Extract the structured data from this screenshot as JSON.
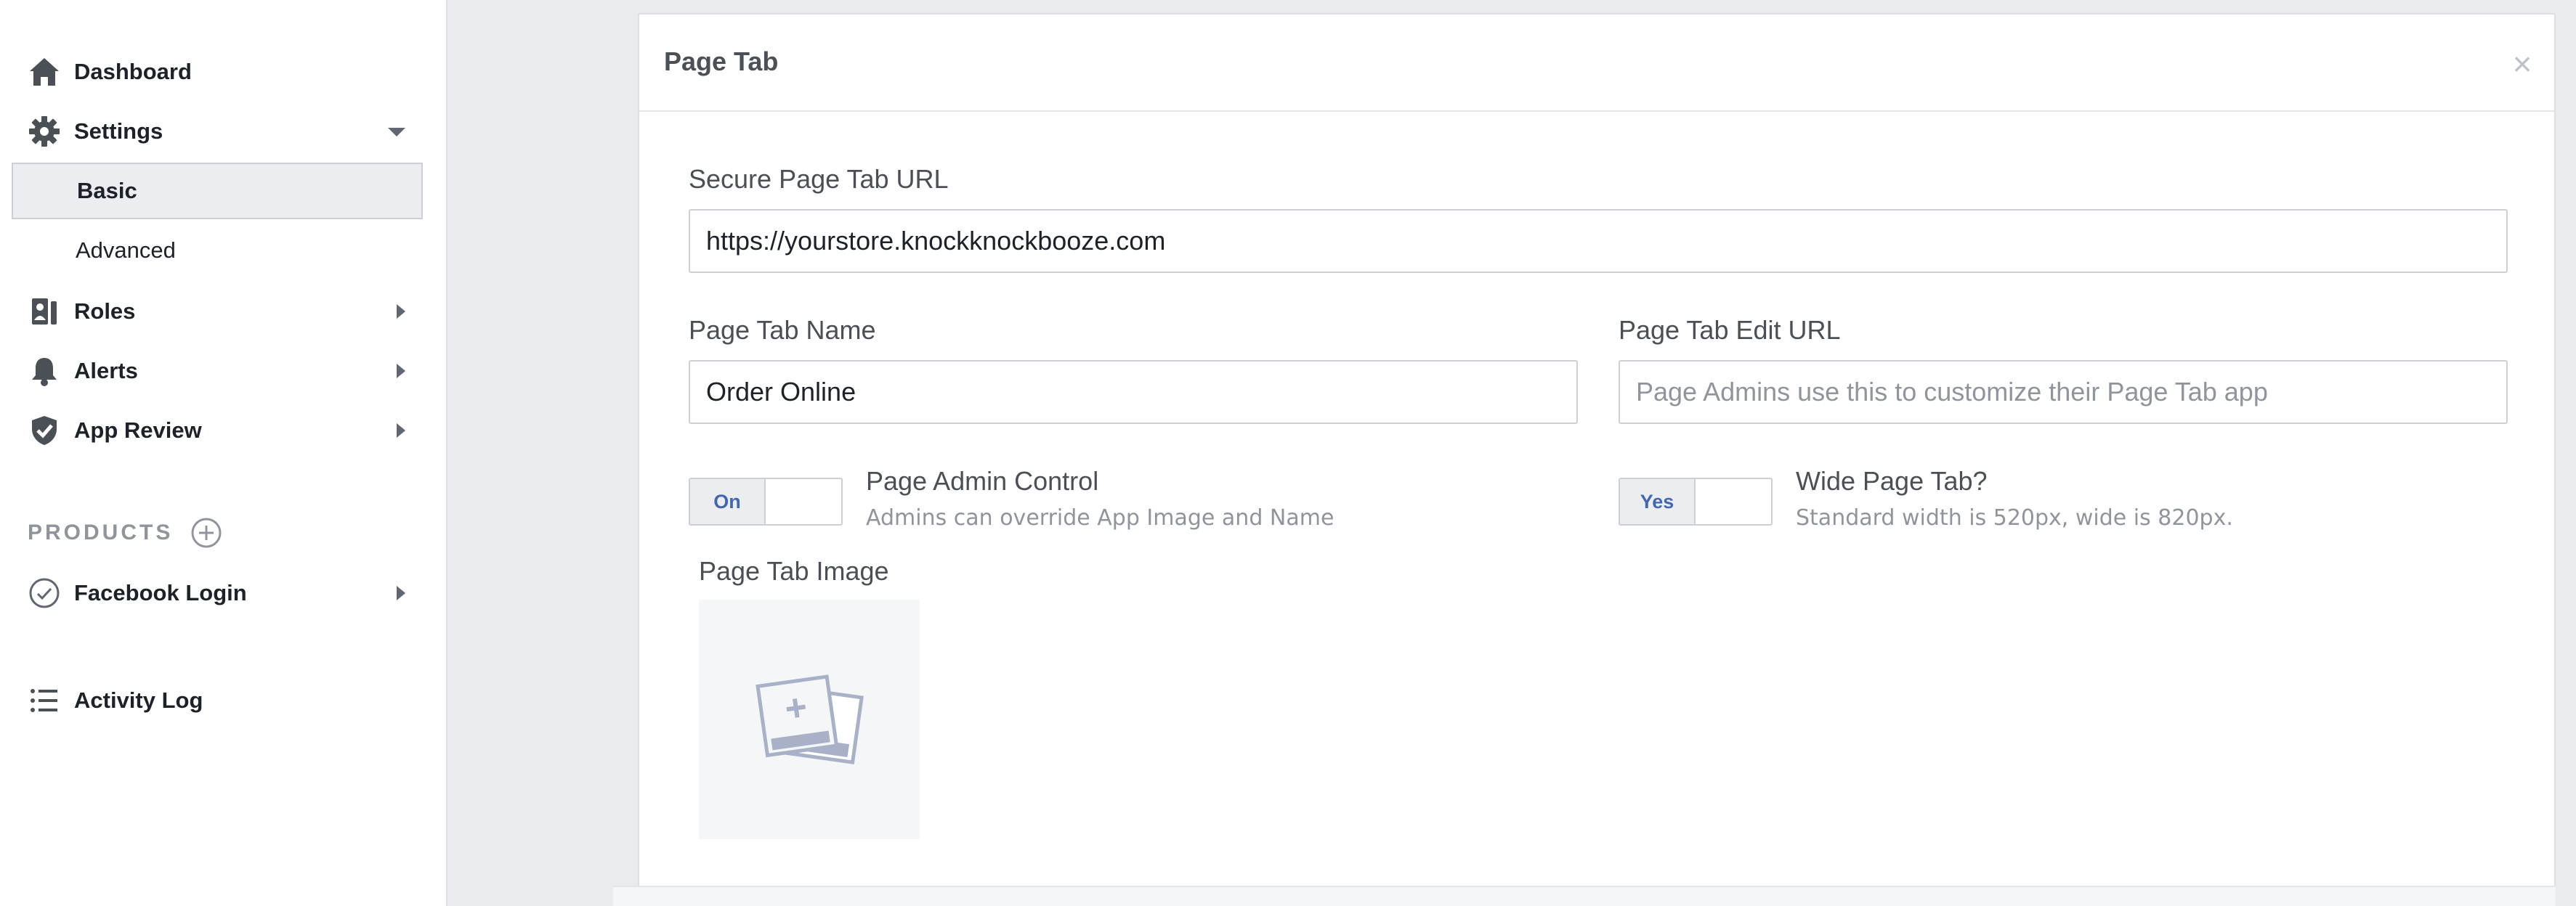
{
  "sidebar": {
    "items": [
      {
        "label": "Dashboard",
        "icon": "home-icon"
      },
      {
        "label": "Settings",
        "icon": "gear-icon"
      },
      {
        "label": "Roles",
        "icon": "roles-icon"
      },
      {
        "label": "Alerts",
        "icon": "bell-icon"
      },
      {
        "label": "App Review",
        "icon": "shield-check-icon"
      },
      {
        "label": "Facebook Login",
        "icon": "check-circle-icon"
      },
      {
        "label": "Activity Log",
        "icon": "list-icon"
      }
    ],
    "settings_sub": [
      {
        "label": "Basic",
        "active": true
      },
      {
        "label": "Advanced",
        "active": false
      }
    ],
    "products_label": "PRODUCTS"
  },
  "dialog": {
    "title": "Page Tab",
    "close_symbol": "×",
    "secure_url": {
      "label": "Secure Page Tab URL",
      "value": "https://yourstore.knockknockbooze.com"
    },
    "tab_name": {
      "label": "Page Tab Name",
      "value": "Order Online"
    },
    "edit_url": {
      "label": "Page Tab Edit URL",
      "placeholder": "Page Admins use this to customize their Page Tab app"
    },
    "admin_control": {
      "toggle_label": "On",
      "title": "Page Admin Control",
      "description": "Admins can override App Image and Name"
    },
    "wide_tab": {
      "toggle_label": "Yes",
      "title": "Wide Page Tab?",
      "description": "Standard width is 520px, wide is 820px."
    },
    "image": {
      "label": "Page Tab Image",
      "icon": "add-image-icon"
    }
  },
  "colors": {
    "background": "#e9ebee",
    "accent": "#4267b2",
    "text": "#1d2129",
    "muted": "#90949c"
  }
}
